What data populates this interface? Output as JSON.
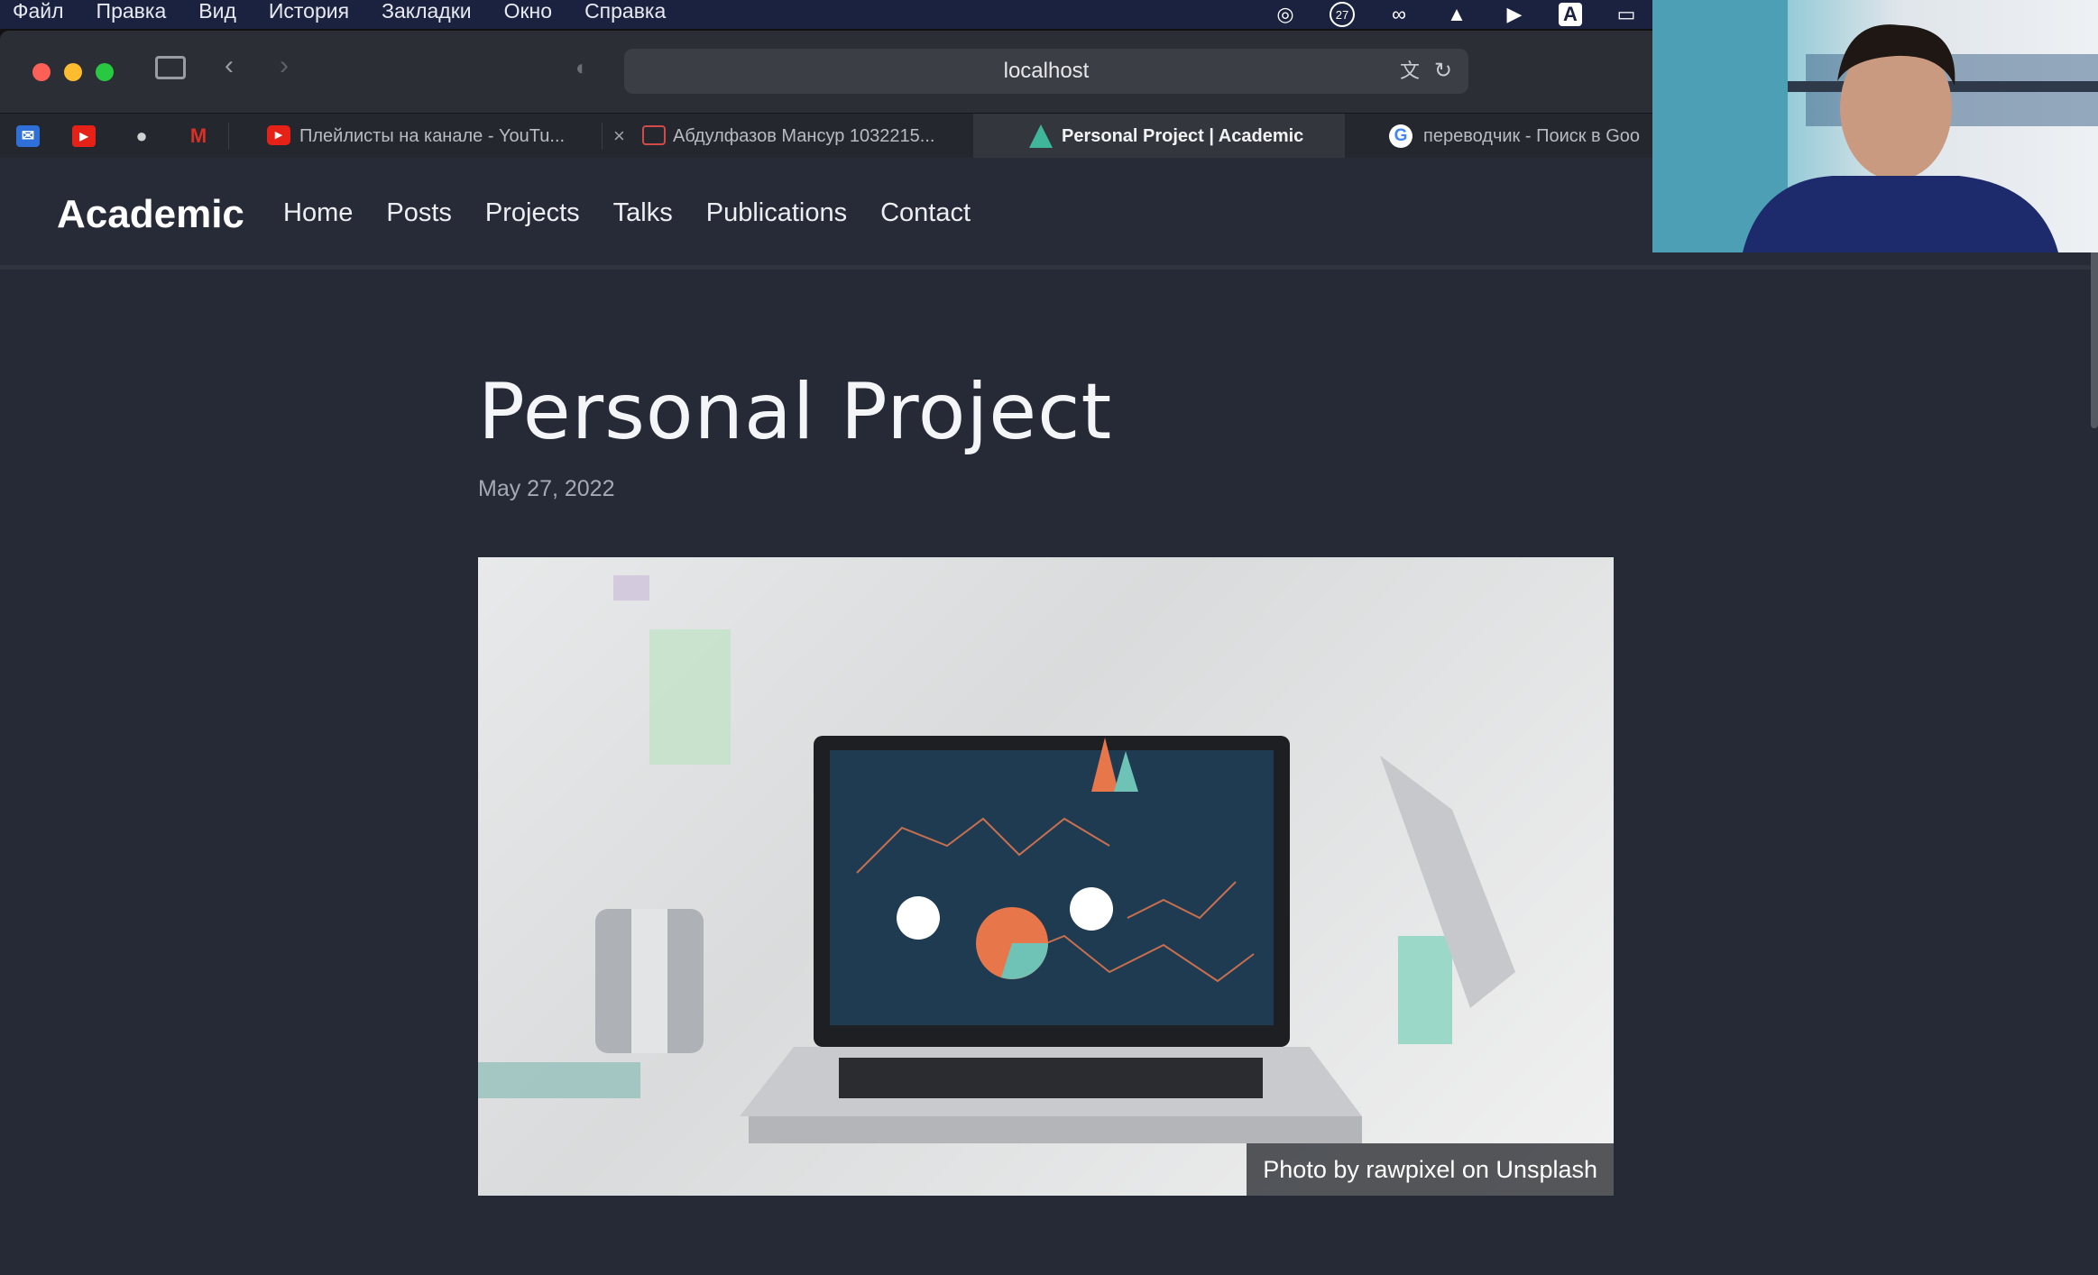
{
  "menubar": {
    "items": [
      "Файл",
      "Правка",
      "Вид",
      "История",
      "Закладки",
      "Окно",
      "Справка"
    ],
    "status_icons": [
      "creative-cloud-icon",
      "calendar-badge-icon",
      "sync-icon",
      "notification-icon",
      "play-icon",
      "input-source-icon",
      "battery-icon"
    ],
    "badge": "27",
    "input_source": "A"
  },
  "browser": {
    "url": "localhost",
    "favorites": [
      {
        "name": "mail",
        "icon": "mail-icon",
        "color": "#2e6fd8"
      },
      {
        "name": "youtube",
        "icon": "youtube-icon",
        "color": "#e62117"
      },
      {
        "name": "apple",
        "icon": "apple-icon",
        "color": "#cfd0d4"
      },
      {
        "name": "gmail",
        "icon": "gmail-icon",
        "color": "#d93025"
      }
    ],
    "tabs": [
      {
        "label": "Плейлисты на канале - YouTu...",
        "icon": "youtube-icon",
        "active": false
      },
      {
        "label": "Абдулфазов Мансур 1032215...",
        "icon": "lms-icon",
        "active": false
      },
      {
        "label": "Personal Project | Academic",
        "icon": "academic-icon",
        "active": true
      },
      {
        "label": "переводчик - Поиск в Goo",
        "icon": "google-icon",
        "active": false
      }
    ]
  },
  "site": {
    "brand": "Academic",
    "nav": [
      "Home",
      "Posts",
      "Projects",
      "Talks",
      "Publications",
      "Contact"
    ],
    "title": "Personal Project",
    "date": "May 27, 2022",
    "image_caption": "Photo by rawpixel on Unsplash"
  },
  "colors": {
    "menubar": "#1b2240",
    "site_background": "#262a36",
    "close": "#fe5f57",
    "minimize": "#febc2e",
    "zoom": "#28c840"
  }
}
